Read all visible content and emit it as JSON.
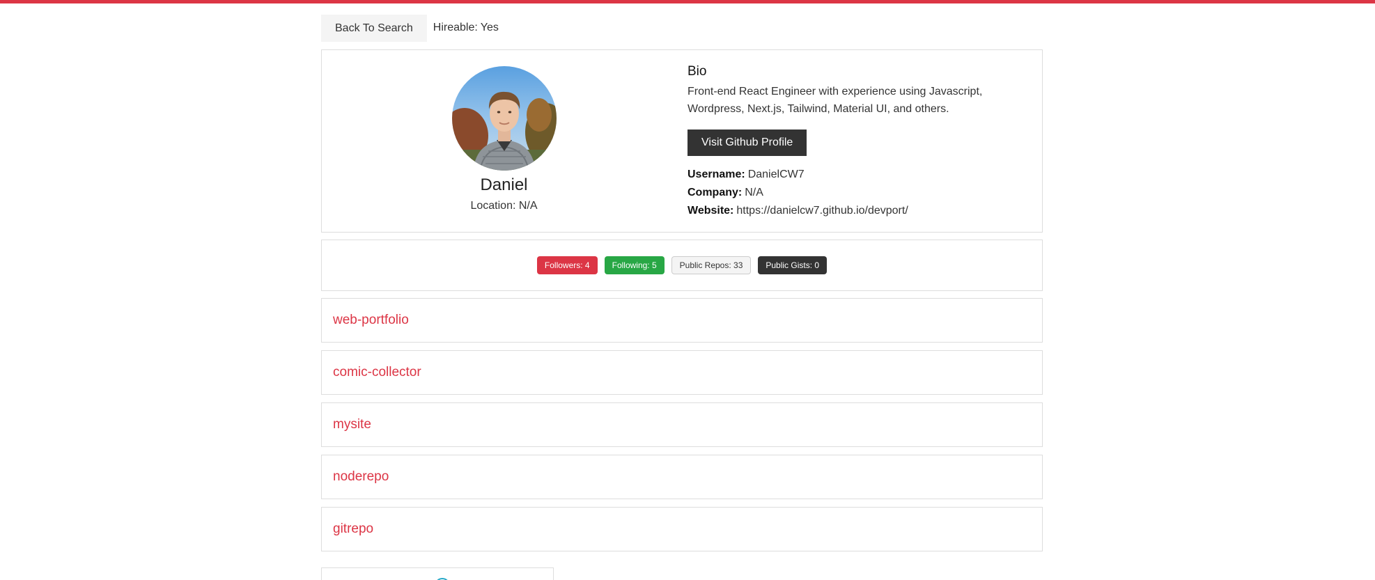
{
  "colors": {
    "accent": "#dc3545",
    "success": "#28a745",
    "dark": "#333333",
    "light": "#f4f4f4"
  },
  "topbar": {
    "back_label": "Back To Search",
    "hireable_label": "Hireable:",
    "hireable_value": "Yes"
  },
  "profile": {
    "name": "Daniel",
    "location": "Location: N/A",
    "avatar_icon": "user-avatar-photo",
    "bio_heading": "Bio",
    "bio_text": "Front-end React Engineer with experience using Javascript, Wordpress, Next.js, Tailwind, Material UI, and others.",
    "github_button": "Visit Github Profile",
    "username_label": "Username:",
    "username_value": "DanielCW7",
    "company_label": "Company:",
    "company_value": "N/A",
    "website_label": "Website:",
    "website_value": "https://danielcw7.github.io/devport/"
  },
  "badges": {
    "followers": "Followers: 4",
    "following": "Following: 5",
    "public_repos": "Public Repos: 33",
    "public_gists": "Public Gists: 0"
  },
  "repos": [
    {
      "name": "web-portfolio"
    },
    {
      "name": "comic-collector"
    },
    {
      "name": "mysite"
    },
    {
      "name": "noderepo"
    },
    {
      "name": "gitrepo"
    }
  ]
}
